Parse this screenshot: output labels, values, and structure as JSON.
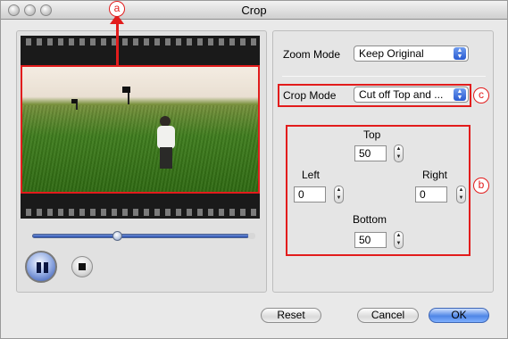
{
  "window": {
    "title": "Crop"
  },
  "preview": {
    "play_icon": "pause-icon",
    "stop_icon": "stop-icon"
  },
  "settings": {
    "zoom_mode_label": "Zoom Mode",
    "zoom_mode_value": "Keep Original",
    "crop_mode_label": "Crop Mode",
    "crop_mode_value": "Cut off Top and ...",
    "top_label": "Top",
    "top_value": "50",
    "left_label": "Left",
    "left_value": "0",
    "right_label": "Right",
    "right_value": "0",
    "bottom_label": "Bottom",
    "bottom_value": "50"
  },
  "callouts": {
    "a": "a",
    "b": "b",
    "c": "c"
  },
  "buttons": {
    "reset": "Reset",
    "cancel": "Cancel",
    "ok": "OK"
  },
  "colors": {
    "highlight_red": "#e21c1c",
    "ok_blue": "#4f86e6"
  }
}
